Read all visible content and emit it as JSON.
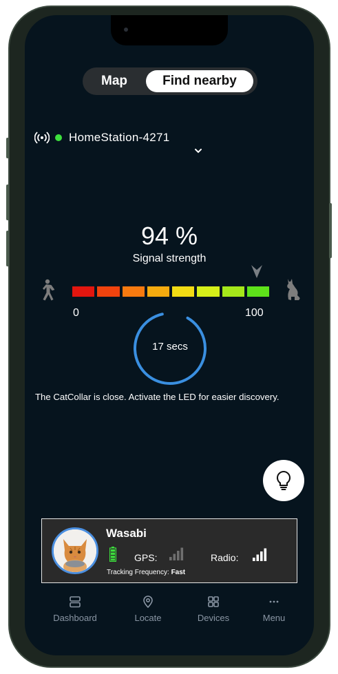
{
  "tabs": {
    "map": "Map",
    "find_nearby": "Find nearby",
    "active": "find_nearby"
  },
  "station": {
    "name": "HomeStation-4271",
    "status_color": "#3de03d"
  },
  "signal": {
    "percent_text": "94 %",
    "label": "Signal strength",
    "value": 94,
    "min_label": "0",
    "max_label": "100",
    "segment_colors": [
      "#e2160f",
      "#f0430e",
      "#f77a10",
      "#f5ab0f",
      "#f2dc14",
      "#d6f019",
      "#a5e81a",
      "#5ee21a"
    ]
  },
  "timer": {
    "text": "17 secs",
    "progress": 0.88
  },
  "message": "The CatCollar is close. Activate the LED for easier discovery.",
  "led_button": {
    "icon": "lightbulb-icon"
  },
  "pet": {
    "name": "Wasabi",
    "gps_label": "GPS:",
    "radio_label": "Radio:",
    "frequency_label": "Tracking Frequency:",
    "frequency_value": "Fast",
    "gps_bars_active": 0,
    "radio_bars_active": 4
  },
  "nav": {
    "items": [
      {
        "label": "Dashboard",
        "icon": "dashboard-icon"
      },
      {
        "label": "Locate",
        "icon": "location-pin-icon"
      },
      {
        "label": "Devices",
        "icon": "devices-grid-icon"
      },
      {
        "label": "Menu",
        "icon": "more-dots-icon"
      }
    ]
  }
}
